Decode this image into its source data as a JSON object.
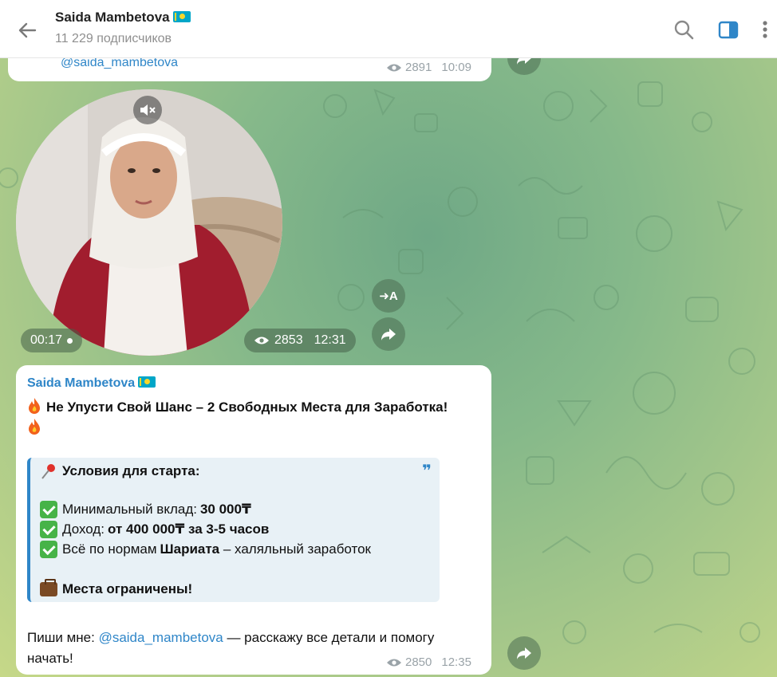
{
  "header": {
    "title": "Saida Mambetova",
    "subscribers": "11 229 подписчиков"
  },
  "top_message": {
    "link": "@saida_mambetova",
    "views": "2891",
    "time": "10:09"
  },
  "video_message": {
    "duration": "00:17",
    "views": "2853",
    "time": "12:31",
    "translate_label": "A"
  },
  "post": {
    "author": "Saida Mambetova",
    "headline": "Не Упусти Свой Шанс – 2 Свободных Места для Заработка!",
    "quote": {
      "title": "Условия для старта:",
      "mark": "❞",
      "items": [
        {
          "label": "Минимальный вклад: ",
          "bold": "30 000₸",
          "after": ""
        },
        {
          "label": "Доход: ",
          "bold": "от 400 000₸ за 3-5 часов",
          "after": ""
        },
        {
          "label": "Всё по нормам ",
          "bold": "Шариата",
          "after": " – халяльный заработок"
        }
      ],
      "footer": "Места ограничены!"
    },
    "cta_prefix": "Пиши мне: ",
    "cta_link": "@saida_mambetova",
    "cta_suffix": " — расскажу все детали и помогу",
    "cta_line2": "начать!",
    "views": "2850",
    "time": "12:35"
  },
  "colors": {
    "accent": "#2f86c8",
    "check": "#46b348",
    "bubble": "#ffffff"
  },
  "icons": [
    "back-arrow-icon",
    "search-icon",
    "sidebar-toggle-icon",
    "more-vertical-icon",
    "eye-icon",
    "forward-icon",
    "mute-icon",
    "translate-icon",
    "fire-icon",
    "pin-icon",
    "check-icon",
    "briefcase-icon"
  ]
}
